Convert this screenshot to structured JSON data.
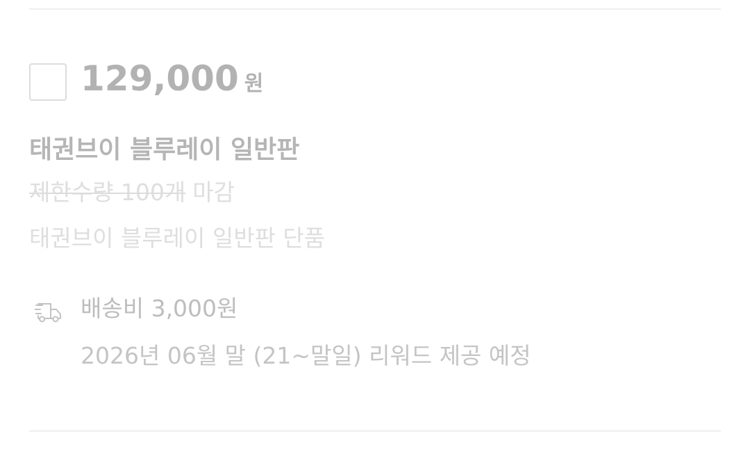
{
  "reward": {
    "price_amount": "129,000",
    "price_unit": "원",
    "title": "태권브이 블루레이 일반판",
    "limit_text": "제한수량 100개",
    "closed_label": "마감",
    "composition": "태권브이 블루레이 일반판 단품",
    "shipping_fee": "배송비 3,000원",
    "delivery_date": "2026년 06월 말 (21~말일) 리워드 제공 예정",
    "selected": false
  },
  "icons": {
    "delivery": "truck-icon"
  },
  "colors": {
    "price": "#b2b2b2",
    "title": "#b5b5b5",
    "muted": "#dedede",
    "secondary": "#bdbdbd",
    "divider": "#efefef",
    "checkbox_border": "#dcdcdc"
  }
}
